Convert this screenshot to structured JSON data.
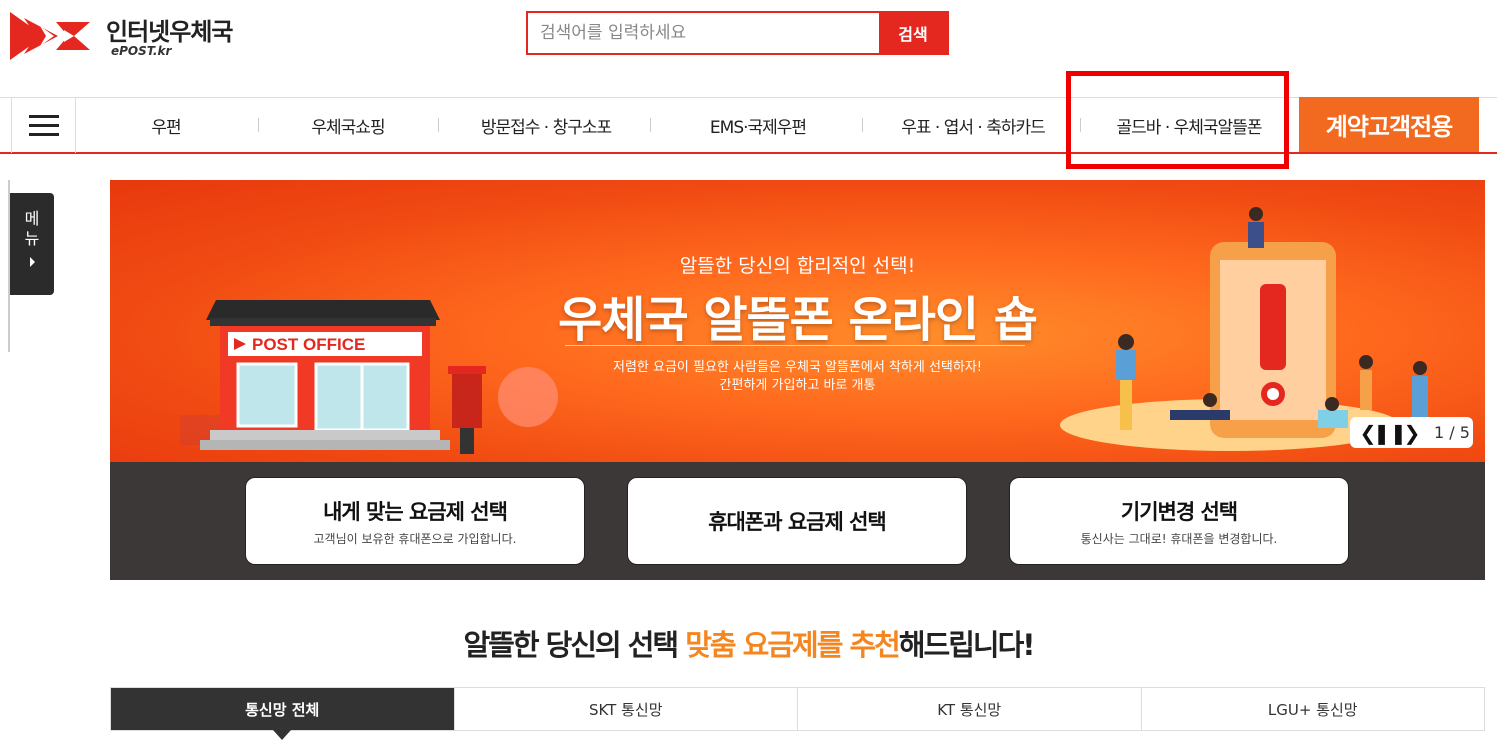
{
  "header": {
    "logo_name": "인터넷우체국",
    "logo_sub": "ePOST.kr",
    "search_placeholder": "검색어를 입력하세요",
    "search_button": "검색"
  },
  "gnb": {
    "items": [
      "우편",
      "우체국쇼핑",
      "방문접수 · 창구소포",
      "EMS·국제우편",
      "우표 · 엽서 · 축하카드",
      "골드바 · 우체국알뜰폰"
    ],
    "contract_button": "계약고객전용"
  },
  "side_tab": {
    "label": "메뉴"
  },
  "banner": {
    "tagline": "알뜰한 당신의 합리적인 선택!",
    "title": "우체국 알뜰폰 온라인 숍",
    "desc_line1": "저렴한 요금이 필요한 사람들은 우체국 알뜰폰에서 착하게 선택하자!",
    "desc_line2": "간편하게 가입하고 바로 개통",
    "post_office_sign": "POST OFFICE",
    "slide_counter": "1 / 5"
  },
  "quick_boxes": [
    {
      "title": "내게 맞는 요금제 선택",
      "subtitle": "고객님이 보유한 휴대폰으로 가입합니다."
    },
    {
      "title": "휴대폰과 요금제 선택",
      "subtitle": ""
    },
    {
      "title": "기기변경 선택",
      "subtitle": "통신사는 그대로! 휴대폰을 변경합니다."
    }
  ],
  "headline": {
    "part1": "알뜰한 당신의 선택 ",
    "highlight": "맞춤 요금제를 추천",
    "part2": "해드립니다!"
  },
  "tabs": [
    "통신망 전체",
    "SKT 통신망",
    "KT 통신망",
    "LGU+ 통신망"
  ],
  "colors": {
    "brand_red": "#e4281f",
    "accent_orange": "#f26a20",
    "highlight_orange": "#f5861f"
  }
}
